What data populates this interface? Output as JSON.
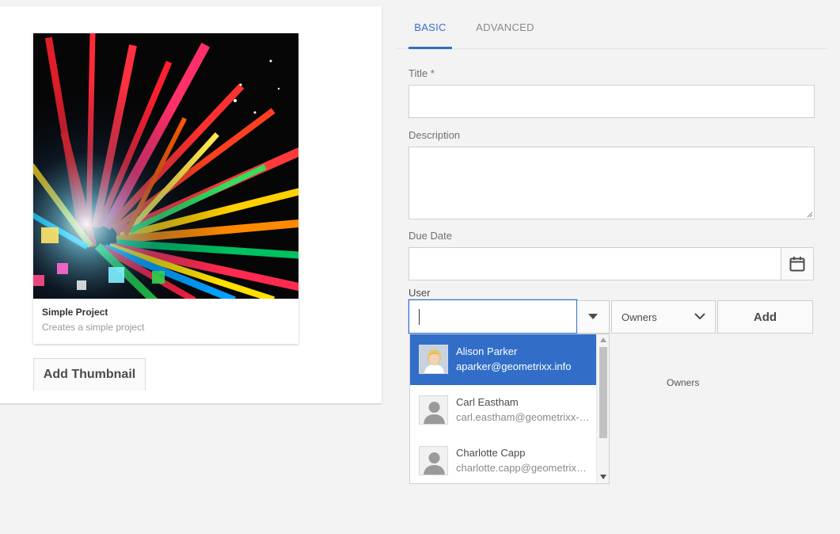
{
  "template_card": {
    "title": "Simple Project",
    "subtitle": "Creates a simple project",
    "thumbnail_button": "Add Thumbnail"
  },
  "tabs": [
    {
      "label": "BASIC",
      "active": true
    },
    {
      "label": "ADVANCED",
      "active": false
    }
  ],
  "form": {
    "title_label": "Title *",
    "title_value": "",
    "description_label": "Description",
    "description_value": "",
    "due_date_label": "Due Date",
    "due_date_value": "",
    "user_label": "User",
    "user_value": "",
    "role_selected": "Owners",
    "add_button": "Add",
    "owners_group_label": "Owners"
  },
  "user_suggestions": [
    {
      "name": "Alison Parker",
      "email": "aparker@geometrixx.info",
      "selected": true,
      "avatar": "photo"
    },
    {
      "name": "Carl Eastham",
      "email": "carl.eastham@geometrixx-media.com",
      "selected": false,
      "avatar": "person-silhouette-icon"
    },
    {
      "name": "Charlotte Capp",
      "email": "charlotte.capp@geometrixx-media.com",
      "selected": false,
      "avatar": "person-silhouette-icon"
    }
  ],
  "icons": {
    "due_date_button": "calendar-icon",
    "user_dropdown": "caret-down-icon",
    "role_dropdown": "chevron-down-icon"
  },
  "colors": {
    "accent": "#326ec8",
    "background": "#f3f3f3",
    "panel": "#ffffff"
  }
}
